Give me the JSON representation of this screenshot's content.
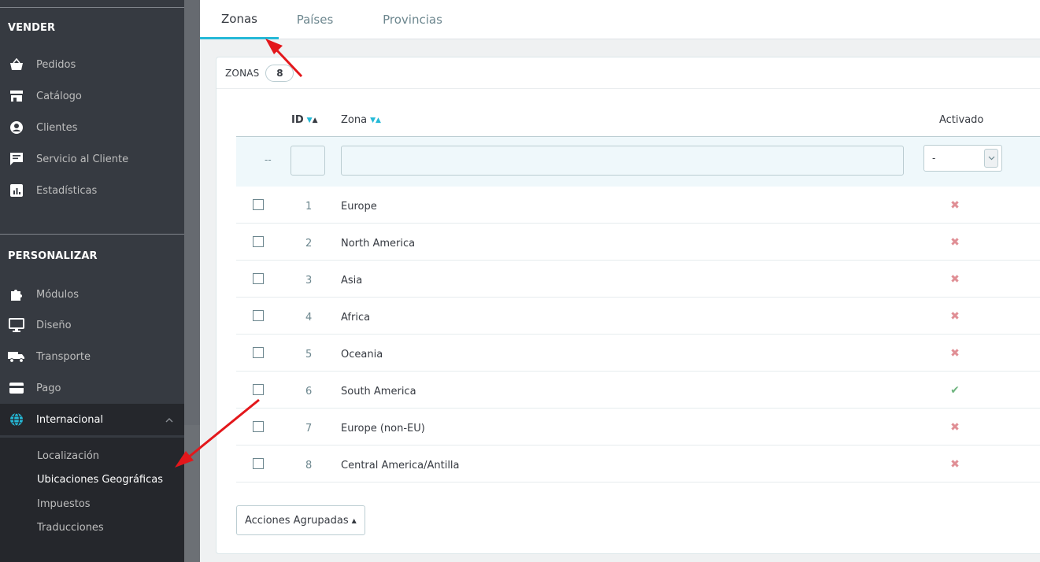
{
  "sidebar": {
    "sections": [
      {
        "title": "VENDER",
        "items": [
          {
            "label": "Pedidos",
            "icon": "basket-icon"
          },
          {
            "label": "Catálogo",
            "icon": "store-icon"
          },
          {
            "label": "Clientes",
            "icon": "account-icon"
          },
          {
            "label": "Servicio al Cliente",
            "icon": "chat-icon"
          },
          {
            "label": "Estadísticas",
            "icon": "bar-chart-icon"
          }
        ]
      },
      {
        "title": "PERSONALIZAR",
        "items": [
          {
            "label": "Módulos",
            "icon": "puzzle-icon"
          },
          {
            "label": "Diseño",
            "icon": "desktop-icon"
          },
          {
            "label": "Transporte",
            "icon": "truck-icon"
          },
          {
            "label": "Pago",
            "icon": "credit-card-icon"
          },
          {
            "label": "Internacional",
            "icon": "globe-icon"
          }
        ]
      }
    ],
    "submenu": [
      "Localización",
      "Ubicaciones Geográficas",
      "Impuestos",
      "Traducciones"
    ]
  },
  "tabs": [
    "Zonas",
    "Países",
    "Provincias"
  ],
  "panel": {
    "title": "ZONAS",
    "count": "8",
    "columns": {
      "id": "ID",
      "zone": "Zona",
      "enabled": "Activado"
    },
    "filter": {
      "dash": "--",
      "select_value": "-"
    },
    "rows": [
      {
        "id": "1",
        "name": "Europe",
        "enabled": false
      },
      {
        "id": "2",
        "name": "North America",
        "enabled": false
      },
      {
        "id": "3",
        "name": "Asia",
        "enabled": false
      },
      {
        "id": "4",
        "name": "Africa",
        "enabled": false
      },
      {
        "id": "5",
        "name": "Oceania",
        "enabled": false
      },
      {
        "id": "6",
        "name": "South America",
        "enabled": true
      },
      {
        "id": "7",
        "name": "Europe (non-EU)",
        "enabled": false
      },
      {
        "id": "8",
        "name": "Central America/Antilla",
        "enabled": false
      }
    ],
    "bulk_actions": "Acciones Agrupadas",
    "colors": {
      "accent": "#25b9d7",
      "disabled_mark": "#e08f95",
      "enabled_mark": "#70b580",
      "annotation_arrow": "#e3171b"
    }
  }
}
